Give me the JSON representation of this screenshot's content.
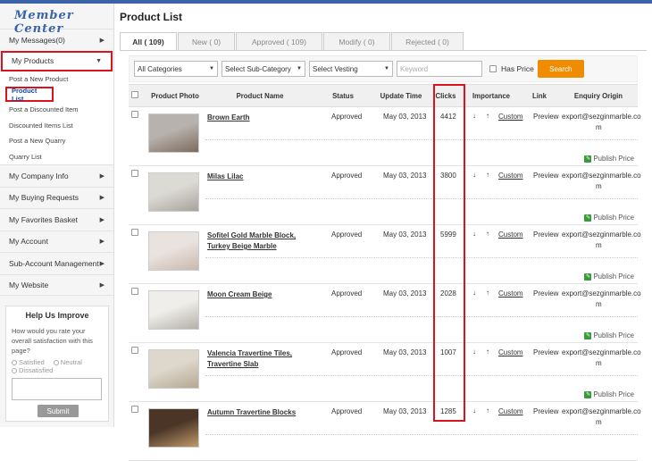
{
  "sidebar": {
    "logo": "Member Center",
    "top_items": [
      {
        "label": "My Messages(0)"
      },
      {
        "label": "My Products"
      }
    ],
    "sub_items": [
      {
        "label": "Post a New Product"
      },
      {
        "label": "Product List"
      },
      {
        "label": "Post a Discounted Item"
      },
      {
        "label": "Discounted Items List"
      },
      {
        "label": "Post a New Quarry"
      },
      {
        "label": "Quarry List"
      }
    ],
    "bottom_items": [
      {
        "label": "My Company Info"
      },
      {
        "label": "My Buying Requests"
      },
      {
        "label": "My Favorites Basket"
      },
      {
        "label": "My Account"
      },
      {
        "label": "Sub-Account Management"
      },
      {
        "label": "My Website"
      }
    ],
    "help": {
      "title": "Help Us Improve",
      "question": "How would you rate your overall satisfaction with this page?",
      "options": [
        "Satisfied",
        "Neutral",
        "Dissatisfied"
      ],
      "submit": "Submit"
    }
  },
  "main": {
    "title": "Product List",
    "tabs": [
      {
        "label": "All ( 109)"
      },
      {
        "label": "New ( 0)"
      },
      {
        "label": "Approved ( 109)"
      },
      {
        "label": "Modify ( 0)"
      },
      {
        "label": "Rejected ( 0)"
      }
    ],
    "filters": {
      "category": "All Categories",
      "subcategory": "Select Sub-Category",
      "vesting": "Select Vesting",
      "keyword_placeholder": "Keyword",
      "has_price": "Has Price",
      "search": "Search"
    },
    "columns": [
      "Product Photo",
      "Product Name",
      "Status",
      "Update Time",
      "Clicks",
      "Importance",
      "Link",
      "Enquiry Origin"
    ],
    "rows": [
      {
        "name": "Brown Earth",
        "status": "Approved",
        "date": "May 03, 2013",
        "clicks": "4412",
        "custom": "Custom",
        "link": "Preview",
        "origin1": "export@sezginmarble.co",
        "origin2": "m",
        "publish": "Publish Price"
      },
      {
        "name": "Milas Lilac",
        "status": "Approved",
        "date": "May 03, 2013",
        "clicks": "3800",
        "custom": "Custom",
        "link": "Preview",
        "origin1": "export@sezginmarble.co",
        "origin2": "m",
        "publish": "Publish Price"
      },
      {
        "name": "Sofitel Gold Marble Block, Turkey Beige Marble",
        "status": "Approved",
        "date": "May 03, 2013",
        "clicks": "5999",
        "custom": "Custom",
        "link": "Preview",
        "origin1": "export@sezginmarble.co",
        "origin2": "m",
        "publish": "Publish Price"
      },
      {
        "name": "Moon Cream Beige",
        "status": "Approved",
        "date": "May 03, 2013",
        "clicks": "2028",
        "custom": "Custom",
        "link": "Preview",
        "origin1": "export@sezginmarble.co",
        "origin2": "m",
        "publish": "Publish Price"
      },
      {
        "name": "Valencia Travertine Tiles, Travertine Slab",
        "status": "Approved",
        "date": "May 03, 2013",
        "clicks": "1007",
        "custom": "Custom",
        "link": "Preview",
        "origin1": "export@sezginmarble.co",
        "origin2": "m",
        "publish": "Publish Price"
      },
      {
        "name": "Autumn Travertine Blocks",
        "status": "Approved",
        "date": "May 03, 2013",
        "clicks": "1285",
        "custom": "Custom",
        "link": "Preview",
        "origin1": "export@sezginmarble.co",
        "origin2": "m",
        "publish": ""
      }
    ]
  },
  "colors": {
    "accent": "#3a63a8",
    "highlight": "#d9141e",
    "search": "#f08c00",
    "link": "#1a4f9e"
  }
}
